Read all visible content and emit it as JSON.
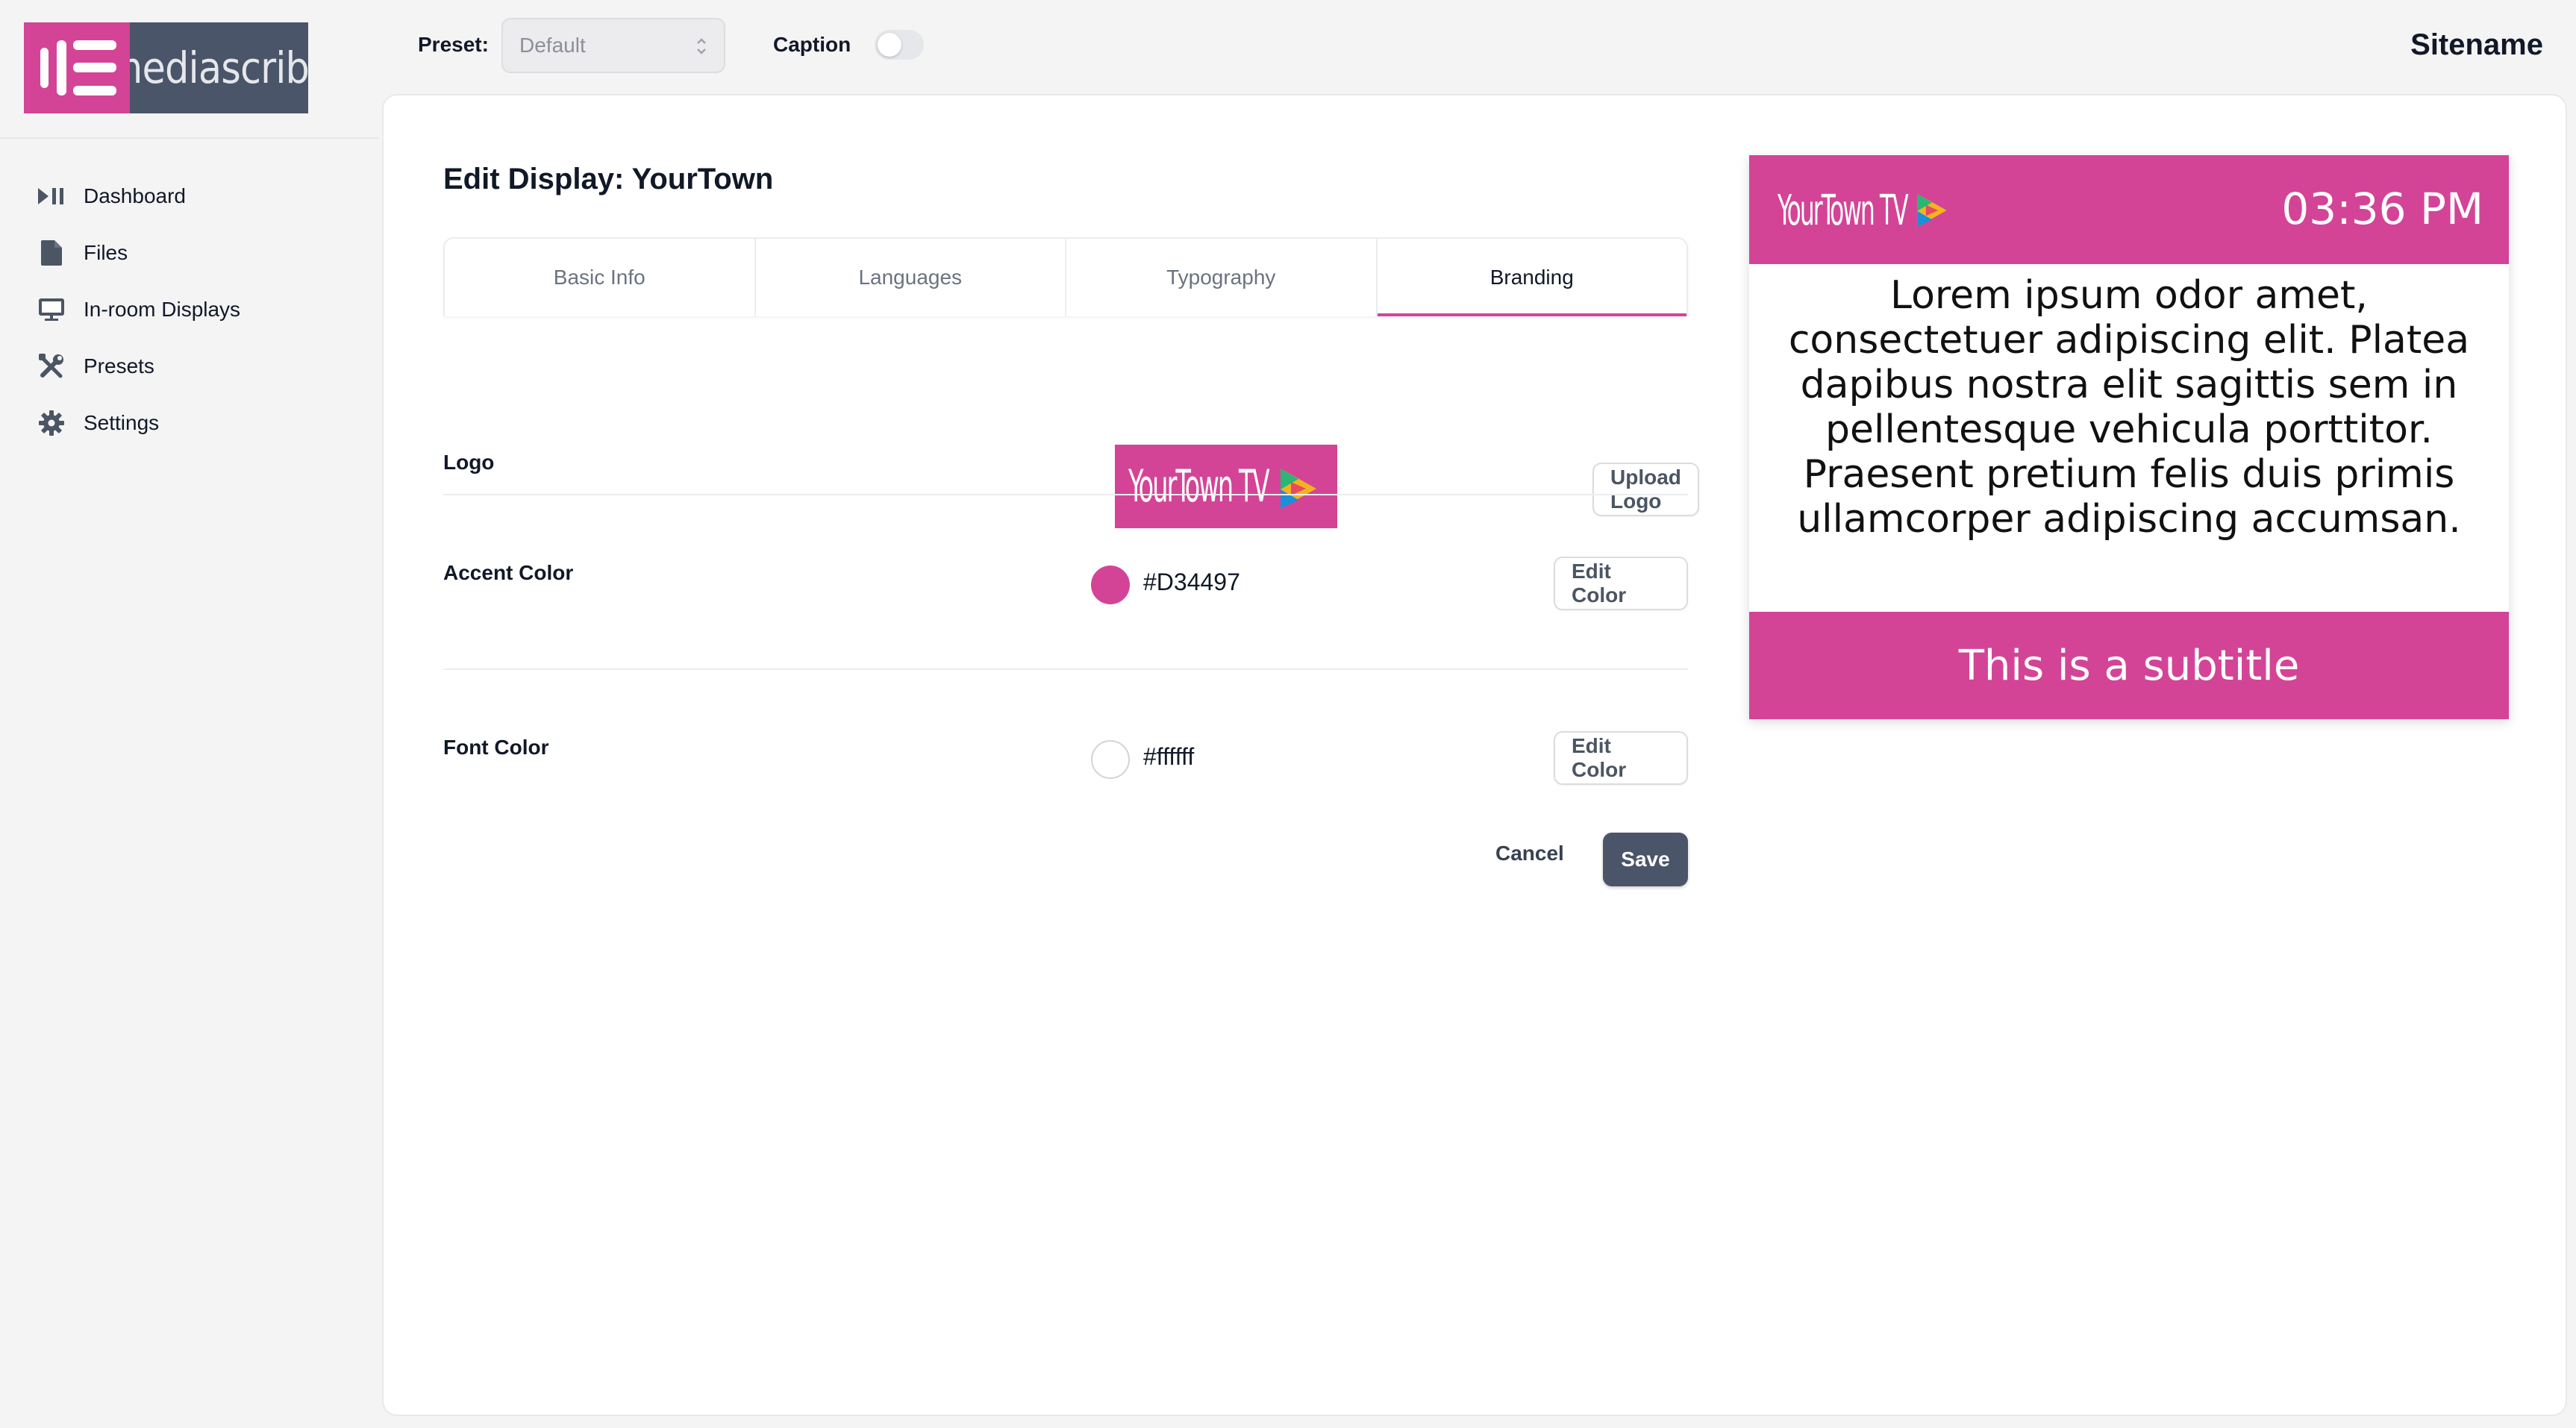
{
  "brand": {
    "name": "mediascribe",
    "accent": "#D34497",
    "dark": "#4B5569"
  },
  "sidebar": {
    "items": [
      {
        "label": "Dashboard",
        "icon": "play-pause-icon"
      },
      {
        "label": "Files",
        "icon": "file-icon"
      },
      {
        "label": "In-room Displays",
        "icon": "monitor-icon"
      },
      {
        "label": "Presets",
        "icon": "tools-icon"
      },
      {
        "label": "Settings",
        "icon": "gear-icon"
      }
    ]
  },
  "topbar": {
    "preset_label": "Preset:",
    "preset_value": "Default",
    "caption_label": "Caption",
    "caption_enabled": false,
    "sitename": "Sitename"
  },
  "editor": {
    "title": "Edit Display: YourTown",
    "tabs": [
      {
        "label": "Basic Info",
        "active": false
      },
      {
        "label": "Languages",
        "active": false
      },
      {
        "label": "Typography",
        "active": false
      },
      {
        "label": "Branding",
        "active": true
      }
    ],
    "logo": {
      "label": "Logo",
      "preview_text": "YourTown TV",
      "upload_label": "Upload Logo"
    },
    "accent_color": {
      "label": "Accent Color",
      "value": "#D34497",
      "edit_label": "Edit Color"
    },
    "font_color": {
      "label": "Font Color",
      "value": "#ffffff",
      "edit_label": "Edit Color"
    },
    "cancel_label": "Cancel",
    "save_label": "Save"
  },
  "preview": {
    "logo_text": "YourTown TV",
    "time": "03:36 PM",
    "body": "Lorem ipsum odor amet, consectetuer adipiscing elit. Platea dapibus nostra elit sagittis sem in pellentesque vehicula porttitor. Praesent pretium felis duis primis ullamcorper adipiscing accumsan.",
    "subtitle": "This is a subtitle"
  }
}
